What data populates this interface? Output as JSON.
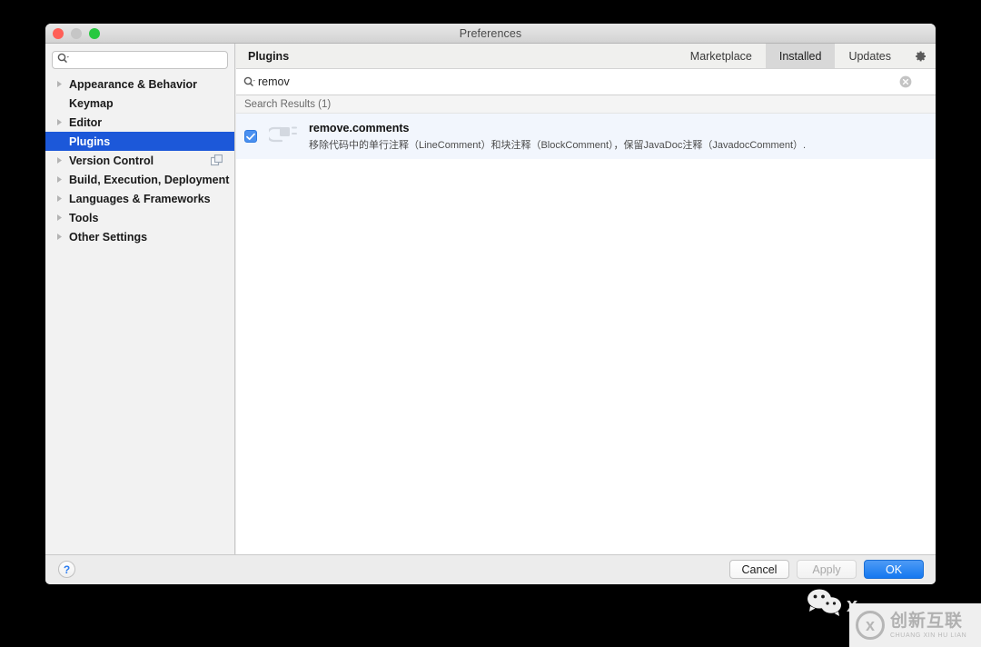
{
  "window": {
    "title": "Preferences",
    "traffic_lights": [
      "close-red",
      "minimize-gray",
      "zoom-green"
    ]
  },
  "sidebar": {
    "search_placeholder": "",
    "search_value": "",
    "items": [
      {
        "label": "Appearance & Behavior",
        "expandable": true,
        "selected": false,
        "trailing_icon": ""
      },
      {
        "label": "Keymap",
        "expandable": false,
        "selected": false,
        "trailing_icon": ""
      },
      {
        "label": "Editor",
        "expandable": true,
        "selected": false,
        "trailing_icon": ""
      },
      {
        "label": "Plugins",
        "expandable": false,
        "selected": true,
        "trailing_icon": ""
      },
      {
        "label": "Version Control",
        "expandable": true,
        "selected": false,
        "trailing_icon": "copy-icon"
      },
      {
        "label": "Build, Execution, Deployment",
        "expandable": true,
        "selected": false,
        "trailing_icon": ""
      },
      {
        "label": "Languages & Frameworks",
        "expandable": true,
        "selected": false,
        "trailing_icon": ""
      },
      {
        "label": "Tools",
        "expandable": true,
        "selected": false,
        "trailing_icon": ""
      },
      {
        "label": "Other Settings",
        "expandable": true,
        "selected": false,
        "trailing_icon": ""
      }
    ]
  },
  "main": {
    "panel_title": "Plugins",
    "tabs": [
      {
        "label": "Marketplace",
        "active": false
      },
      {
        "label": "Installed",
        "active": true
      },
      {
        "label": "Updates",
        "active": false
      }
    ],
    "gear_icon": "gear-icon",
    "search": {
      "value": "remov",
      "placeholder": "",
      "clear_icon": "clear-circle-icon",
      "search_icon": "search-icon"
    },
    "results_header": "Search Results (1)",
    "plugins": [
      {
        "name": "remove.comments",
        "description": "移除代码中的单行注释（LineComment）和块注释（BlockComment），保留JavaDoc注释（JavadocComment）.",
        "enabled": true,
        "icon": "plug-icon"
      }
    ]
  },
  "footer": {
    "help_label": "?",
    "buttons": [
      {
        "label": "Cancel",
        "style": "normal"
      },
      {
        "label": "Apply",
        "style": "disabled"
      },
      {
        "label": "OK",
        "style": "default"
      }
    ]
  },
  "watermark": {
    "wechat_icon": "wechat-icon",
    "wechat_text": "x",
    "brand_logo": "cx-logo",
    "brand_name": "创新互联",
    "brand_pinyin": "CHUANG XIN HU LIAN"
  },
  "colors": {
    "selection_blue": "#1c58d9",
    "ok_button_blue": "#1478f0",
    "row_highlight": "#f2f6fd",
    "checkbox_blue": "#4a90f0"
  }
}
